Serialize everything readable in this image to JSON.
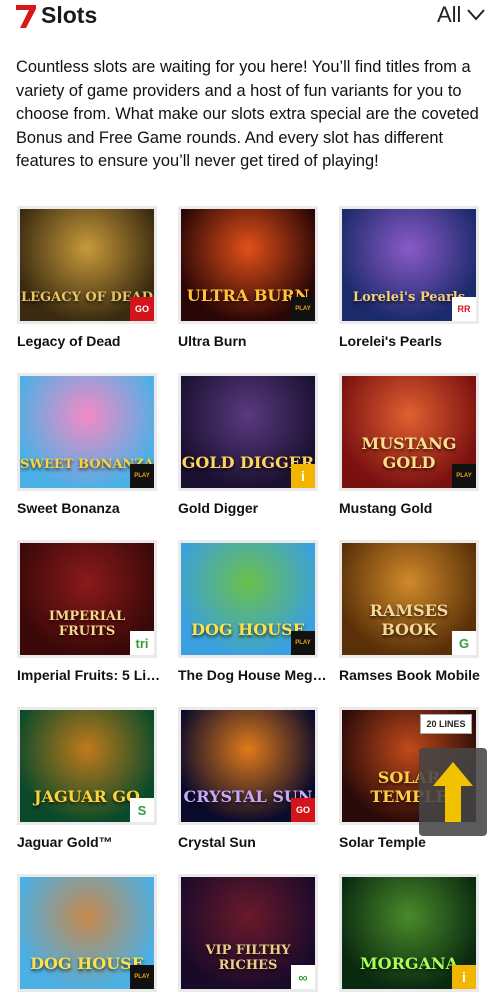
{
  "header": {
    "title": "Slots",
    "filter_label": "All",
    "logo_icon": "seven-icon",
    "filter_icon": "chevron-down-icon"
  },
  "intro": {
    "text": "Countless slots are waiting for you here! You’ll find titles from a variety of game providers and a host of fun variants for you to choose from. What make our slots extra special are the coveted Bonus and Free Game rounds. And every slot has different features to ensure you’ll never get tired of playing!"
  },
  "games": [
    {
      "name": "Legacy of Dead",
      "art_text": "LEGACY OF DEAD",
      "provider": "GO",
      "colors": [
        "#3a2a10",
        "#c79a3a"
      ],
      "text_color": "#e8c56b"
    },
    {
      "name": "Ultra Burn",
      "art_text": "ULTRA BURN",
      "provider": "PLAY",
      "colors": [
        "#2a0606",
        "#e0501a"
      ],
      "text_color": "#ffc23a"
    },
    {
      "name": "Lorelei's Pearls",
      "art_text": "Lorelei's Pearls",
      "provider": "RR",
      "colors": [
        "#1a2a6a",
        "#8a5ac8"
      ],
      "text_color": "#f3d27a"
    },
    {
      "name": "Sweet Bonanza",
      "art_text": "SWEET BONANZA",
      "provider": "PLAY",
      "colors": [
        "#4bb0e6",
        "#f58ac4"
      ],
      "text_color": "#ffd23a"
    },
    {
      "name": "Gold Digger",
      "art_text": "GOLD DIGGER",
      "provider": "i",
      "colors": [
        "#1a1030",
        "#5a3a80"
      ],
      "text_color": "#ffd55a"
    },
    {
      "name": "Mustang Gold",
      "art_text": "MUSTANG GOLD",
      "provider": "PLAY",
      "colors": [
        "#7a1010",
        "#e06030"
      ],
      "text_color": "#ffe08a"
    },
    {
      "name": "Imperial Fruits: 5 Lines",
      "art_text": "IMPERIAL FRUITS",
      "provider": "tri",
      "colors": [
        "#3a0808",
        "#8a1a1a"
      ],
      "text_color": "#f6d68a"
    },
    {
      "name": "The Dog House Mega...",
      "art_text": "DOG HOUSE",
      "provider": "PLAY",
      "colors": [
        "#3aa0e0",
        "#6ac04a"
      ],
      "text_color": "#ffe14a"
    },
    {
      "name": "Ramses Book Mobile",
      "art_text": "RAMSES BOOK",
      "provider": "G",
      "colors": [
        "#5a3008",
        "#d08a2a"
      ],
      "text_color": "#f5d79a"
    },
    {
      "name": "Jaguar Gold™",
      "art_text": "JAGUAR GO",
      "provider": "S",
      "colors": [
        "#0a4a2a",
        "#c07a1a"
      ],
      "text_color": "#ffd23a"
    },
    {
      "name": "Crystal Sun",
      "art_text": "CRYSTAL SUN",
      "provider": "GO",
      "colors": [
        "#0a0a2a",
        "#e07a1a"
      ],
      "text_color": "#c8a8ff"
    },
    {
      "name": "Solar Temple",
      "art_text": "SOLAR TEMPLE",
      "provider": "20 LINES",
      "colors": [
        "#2a0a08",
        "#c04a1a"
      ],
      "text_color": "#ffcf4a"
    },
    {
      "name": "",
      "art_text": "DOG HOUSE",
      "provider": "PLAY",
      "colors": [
        "#4ab0e6",
        "#c8884a"
      ],
      "text_color": "#ffe14a"
    },
    {
      "name": "",
      "art_text": "VIP FILTHY RICHES",
      "provider": "∞",
      "colors": [
        "#1a0a2a",
        "#6a1a2a"
      ],
      "text_color": "#e8d08a"
    },
    {
      "name": "",
      "art_text": "MORGANA",
      "provider": "i",
      "colors": [
        "#0a2a10",
        "#4a8a2a"
      ],
      "text_color": "#a4ff5a"
    }
  ],
  "scroll_top_icon": "arrow-up-icon",
  "accent_color": "#f2c200"
}
